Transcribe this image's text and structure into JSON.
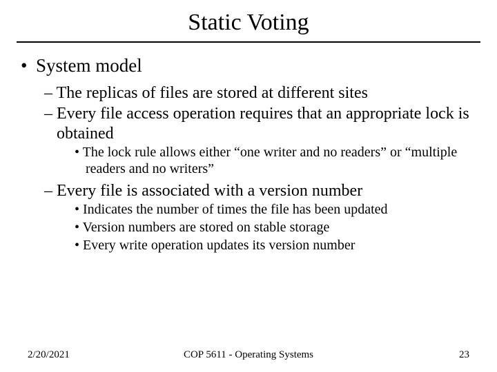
{
  "title": "Static Voting",
  "bullets": {
    "l1": "System model",
    "l2_1": "The replicas of files are stored at different sites",
    "l2_2": "Every file access operation requires that an appropriate lock is obtained",
    "l3_1": "The lock rule allows either “one writer and no readers” or “multiple readers and no writers”",
    "l2_3": "Every file is associated with a version number",
    "l3_2": "Indicates the number of times the file has been updated",
    "l3_3": "Version numbers are stored on stable storage",
    "l3_4": "Every write operation updates its version number"
  },
  "footer": {
    "date": "2/20/2021",
    "course": "COP 5611 - Operating Systems",
    "page": "23"
  }
}
